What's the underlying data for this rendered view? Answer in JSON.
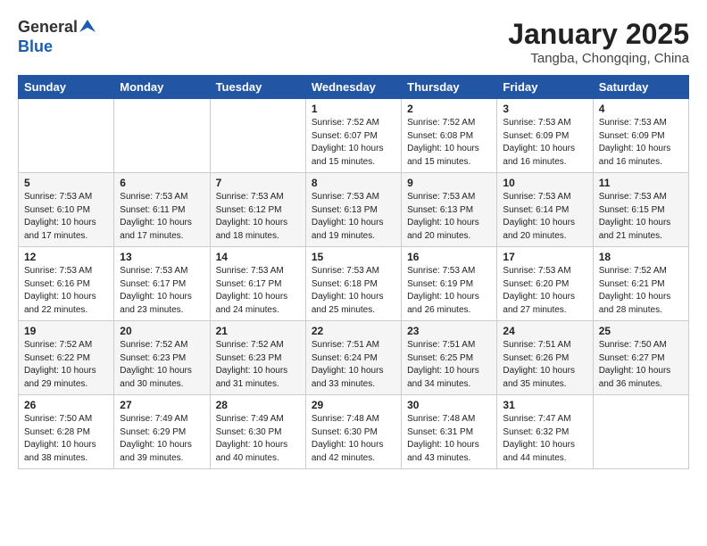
{
  "header": {
    "logo_general": "General",
    "logo_blue": "Blue",
    "month_title": "January 2025",
    "location": "Tangba, Chongqing, China"
  },
  "weekdays": [
    "Sunday",
    "Monday",
    "Tuesday",
    "Wednesday",
    "Thursday",
    "Friday",
    "Saturday"
  ],
  "weeks": [
    [
      {
        "day": "",
        "info": ""
      },
      {
        "day": "",
        "info": ""
      },
      {
        "day": "",
        "info": ""
      },
      {
        "day": "1",
        "info": "Sunrise: 7:52 AM\nSunset: 6:07 PM\nDaylight: 10 hours\nand 15 minutes."
      },
      {
        "day": "2",
        "info": "Sunrise: 7:52 AM\nSunset: 6:08 PM\nDaylight: 10 hours\nand 15 minutes."
      },
      {
        "day": "3",
        "info": "Sunrise: 7:53 AM\nSunset: 6:09 PM\nDaylight: 10 hours\nand 16 minutes."
      },
      {
        "day": "4",
        "info": "Sunrise: 7:53 AM\nSunset: 6:09 PM\nDaylight: 10 hours\nand 16 minutes."
      }
    ],
    [
      {
        "day": "5",
        "info": "Sunrise: 7:53 AM\nSunset: 6:10 PM\nDaylight: 10 hours\nand 17 minutes."
      },
      {
        "day": "6",
        "info": "Sunrise: 7:53 AM\nSunset: 6:11 PM\nDaylight: 10 hours\nand 17 minutes."
      },
      {
        "day": "7",
        "info": "Sunrise: 7:53 AM\nSunset: 6:12 PM\nDaylight: 10 hours\nand 18 minutes."
      },
      {
        "day": "8",
        "info": "Sunrise: 7:53 AM\nSunset: 6:13 PM\nDaylight: 10 hours\nand 19 minutes."
      },
      {
        "day": "9",
        "info": "Sunrise: 7:53 AM\nSunset: 6:13 PM\nDaylight: 10 hours\nand 20 minutes."
      },
      {
        "day": "10",
        "info": "Sunrise: 7:53 AM\nSunset: 6:14 PM\nDaylight: 10 hours\nand 20 minutes."
      },
      {
        "day": "11",
        "info": "Sunrise: 7:53 AM\nSunset: 6:15 PM\nDaylight: 10 hours\nand 21 minutes."
      }
    ],
    [
      {
        "day": "12",
        "info": "Sunrise: 7:53 AM\nSunset: 6:16 PM\nDaylight: 10 hours\nand 22 minutes."
      },
      {
        "day": "13",
        "info": "Sunrise: 7:53 AM\nSunset: 6:17 PM\nDaylight: 10 hours\nand 23 minutes."
      },
      {
        "day": "14",
        "info": "Sunrise: 7:53 AM\nSunset: 6:17 PM\nDaylight: 10 hours\nand 24 minutes."
      },
      {
        "day": "15",
        "info": "Sunrise: 7:53 AM\nSunset: 6:18 PM\nDaylight: 10 hours\nand 25 minutes."
      },
      {
        "day": "16",
        "info": "Sunrise: 7:53 AM\nSunset: 6:19 PM\nDaylight: 10 hours\nand 26 minutes."
      },
      {
        "day": "17",
        "info": "Sunrise: 7:53 AM\nSunset: 6:20 PM\nDaylight: 10 hours\nand 27 minutes."
      },
      {
        "day": "18",
        "info": "Sunrise: 7:52 AM\nSunset: 6:21 PM\nDaylight: 10 hours\nand 28 minutes."
      }
    ],
    [
      {
        "day": "19",
        "info": "Sunrise: 7:52 AM\nSunset: 6:22 PM\nDaylight: 10 hours\nand 29 minutes."
      },
      {
        "day": "20",
        "info": "Sunrise: 7:52 AM\nSunset: 6:23 PM\nDaylight: 10 hours\nand 30 minutes."
      },
      {
        "day": "21",
        "info": "Sunrise: 7:52 AM\nSunset: 6:23 PM\nDaylight: 10 hours\nand 31 minutes."
      },
      {
        "day": "22",
        "info": "Sunrise: 7:51 AM\nSunset: 6:24 PM\nDaylight: 10 hours\nand 33 minutes."
      },
      {
        "day": "23",
        "info": "Sunrise: 7:51 AM\nSunset: 6:25 PM\nDaylight: 10 hours\nand 34 minutes."
      },
      {
        "day": "24",
        "info": "Sunrise: 7:51 AM\nSunset: 6:26 PM\nDaylight: 10 hours\nand 35 minutes."
      },
      {
        "day": "25",
        "info": "Sunrise: 7:50 AM\nSunset: 6:27 PM\nDaylight: 10 hours\nand 36 minutes."
      }
    ],
    [
      {
        "day": "26",
        "info": "Sunrise: 7:50 AM\nSunset: 6:28 PM\nDaylight: 10 hours\nand 38 minutes."
      },
      {
        "day": "27",
        "info": "Sunrise: 7:49 AM\nSunset: 6:29 PM\nDaylight: 10 hours\nand 39 minutes."
      },
      {
        "day": "28",
        "info": "Sunrise: 7:49 AM\nSunset: 6:30 PM\nDaylight: 10 hours\nand 40 minutes."
      },
      {
        "day": "29",
        "info": "Sunrise: 7:48 AM\nSunset: 6:30 PM\nDaylight: 10 hours\nand 42 minutes."
      },
      {
        "day": "30",
        "info": "Sunrise: 7:48 AM\nSunset: 6:31 PM\nDaylight: 10 hours\nand 43 minutes."
      },
      {
        "day": "31",
        "info": "Sunrise: 7:47 AM\nSunset: 6:32 PM\nDaylight: 10 hours\nand 44 minutes."
      },
      {
        "day": "",
        "info": ""
      }
    ]
  ]
}
